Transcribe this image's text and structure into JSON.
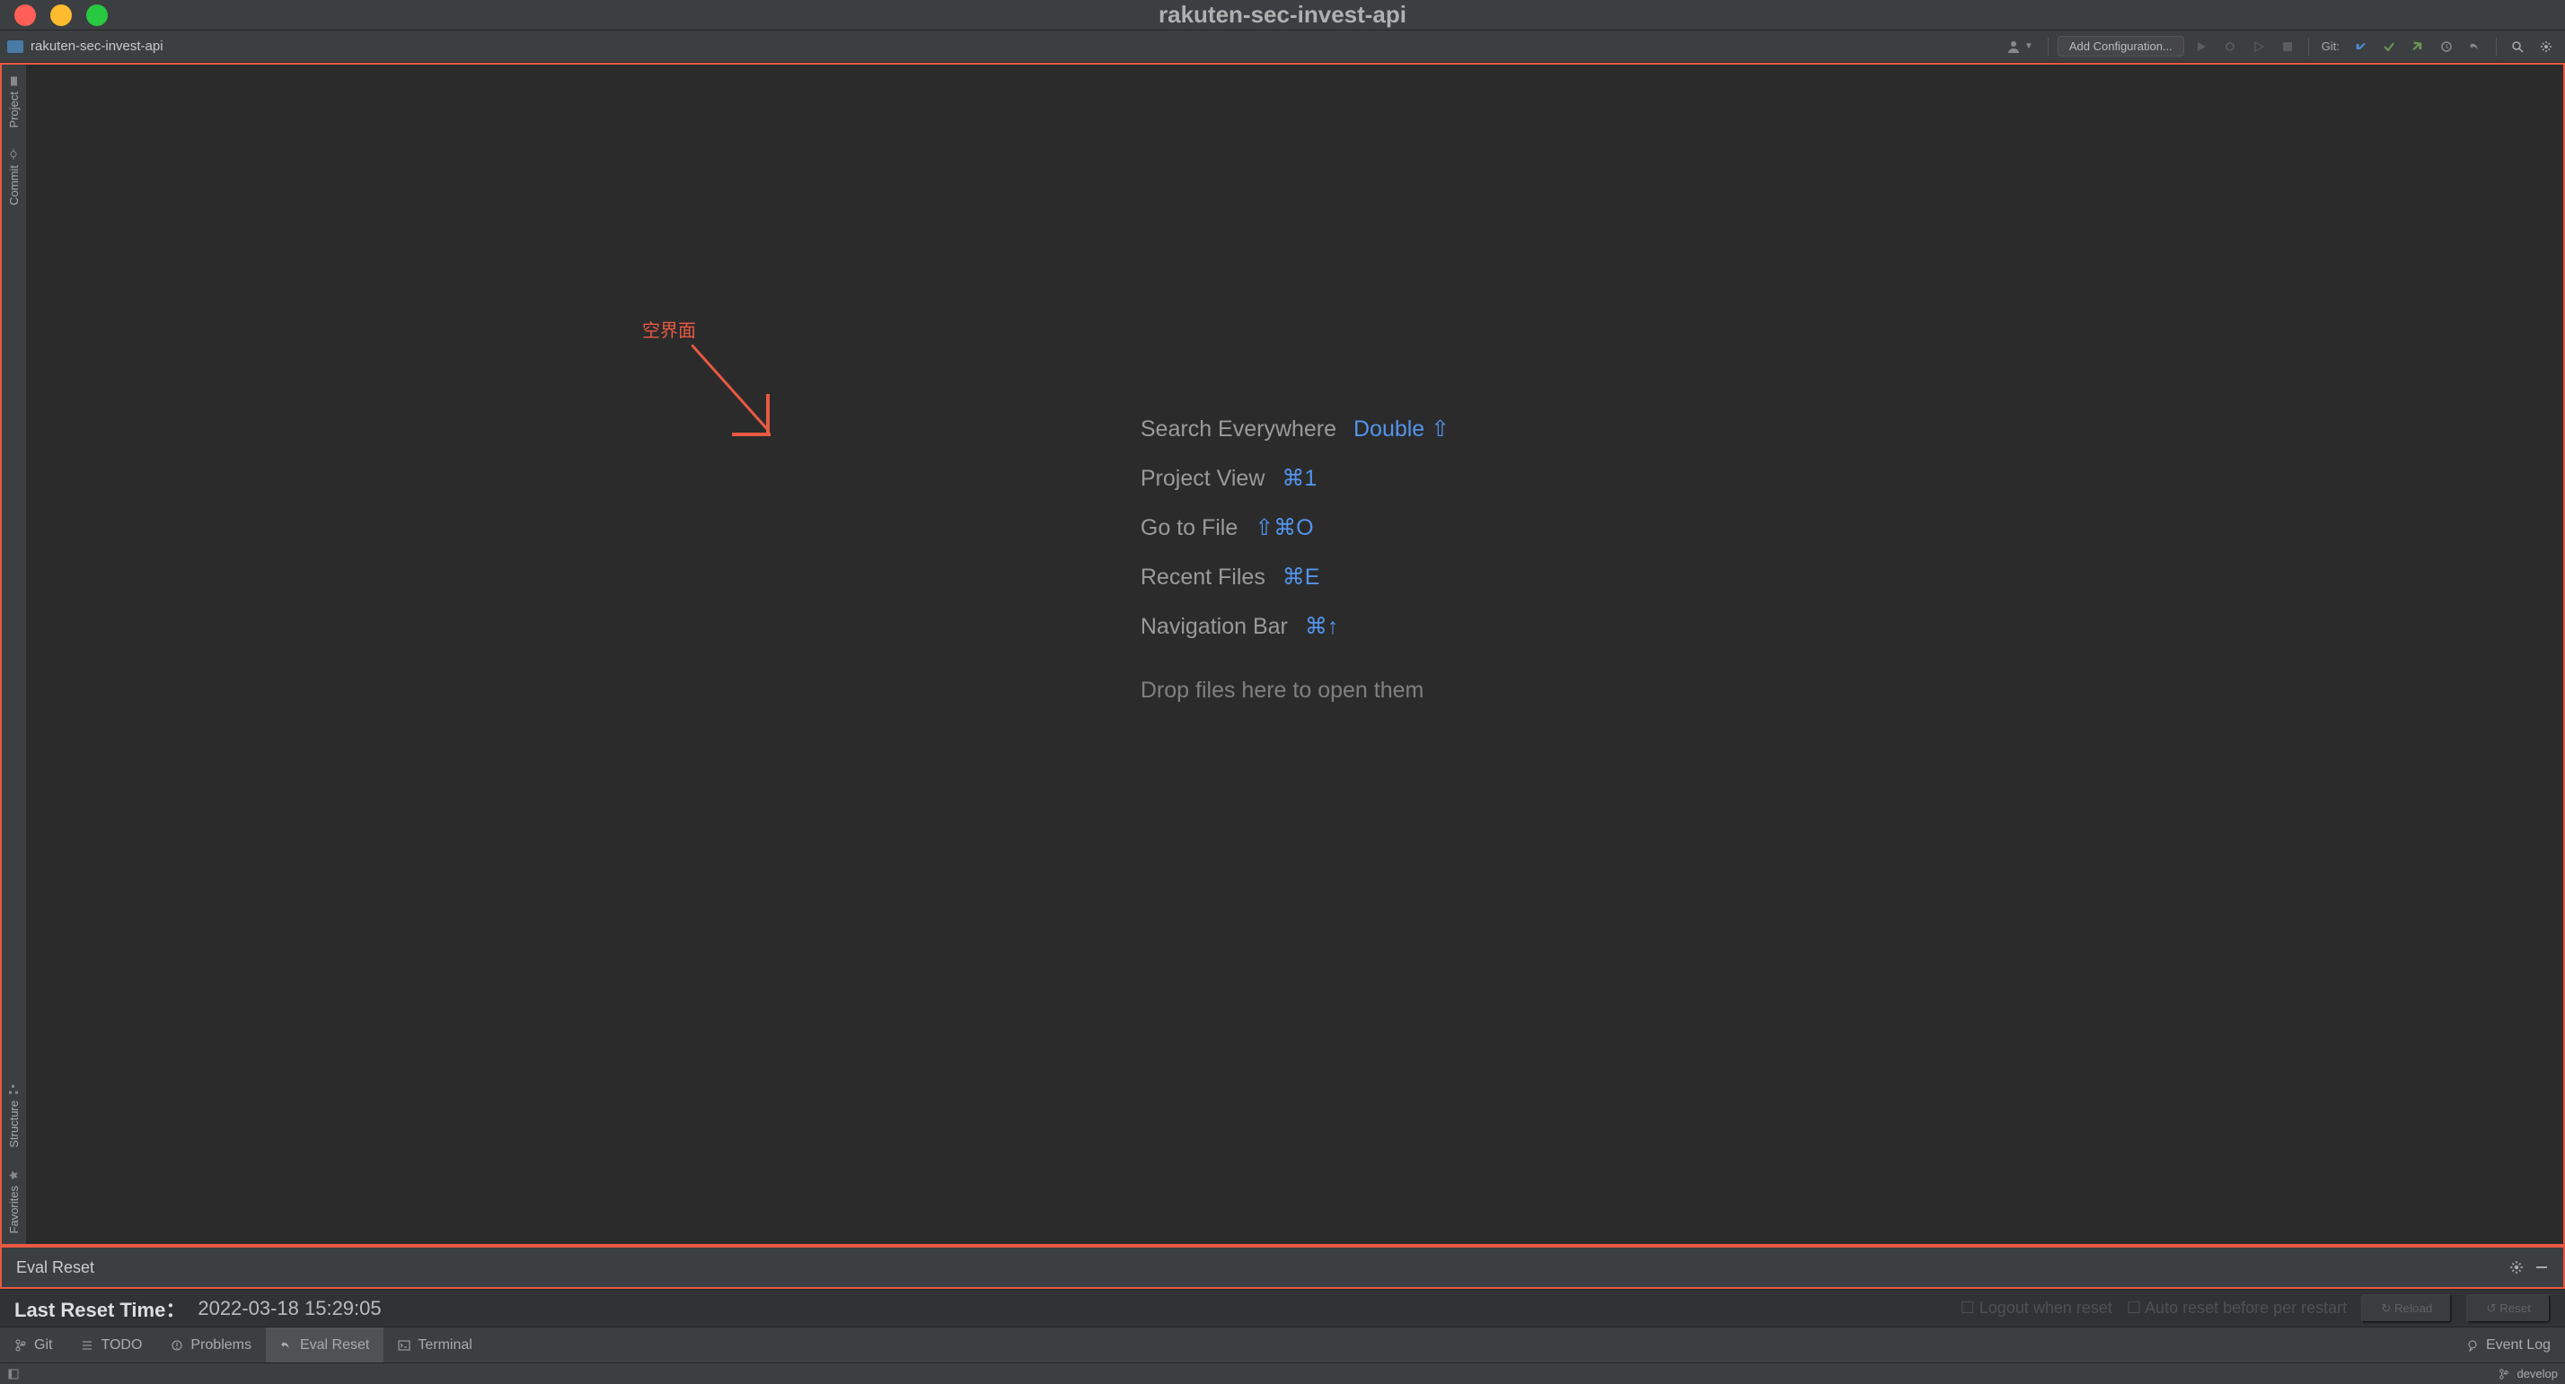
{
  "window": {
    "title": "rakuten-sec-invest-api"
  },
  "navbar": {
    "project_name": "rakuten-sec-invest-api",
    "add_config": "Add Configuration...",
    "git_label": "Git:"
  },
  "left_rail": {
    "top": [
      {
        "label": "Project",
        "icon": "folder"
      },
      {
        "label": "Commit",
        "icon": "commit"
      }
    ],
    "bottom": [
      {
        "label": "Structure",
        "icon": "structure"
      },
      {
        "label": "Favorites",
        "icon": "star"
      }
    ]
  },
  "annotation": "空界面",
  "hints": [
    {
      "label": "Search Everywhere",
      "key": "Double ⇧"
    },
    {
      "label": "Project View",
      "key": "⌘1"
    },
    {
      "label": "Go to File",
      "key": "⇧⌘O"
    },
    {
      "label": "Recent Files",
      "key": "⌘E"
    },
    {
      "label": "Navigation Bar",
      "key": "⌘↑"
    }
  ],
  "drop_hint": "Drop files here to open them",
  "panel": {
    "header": "Eval Reset",
    "last_reset_label": "Last Reset Time：",
    "last_reset_value": "2022-03-18 15:29:05",
    "logout_cb": "Logout when reset",
    "autoreset_cb": "Auto reset before per restart",
    "reload_btn": "Reload",
    "reset_btn": "Reset"
  },
  "bottom": {
    "git": "Git",
    "todo": "TODO",
    "problems": "Problems",
    "eval_reset": "Eval Reset",
    "terminal": "Terminal",
    "event_log": "Event Log"
  },
  "status": {
    "branch": "develop"
  }
}
